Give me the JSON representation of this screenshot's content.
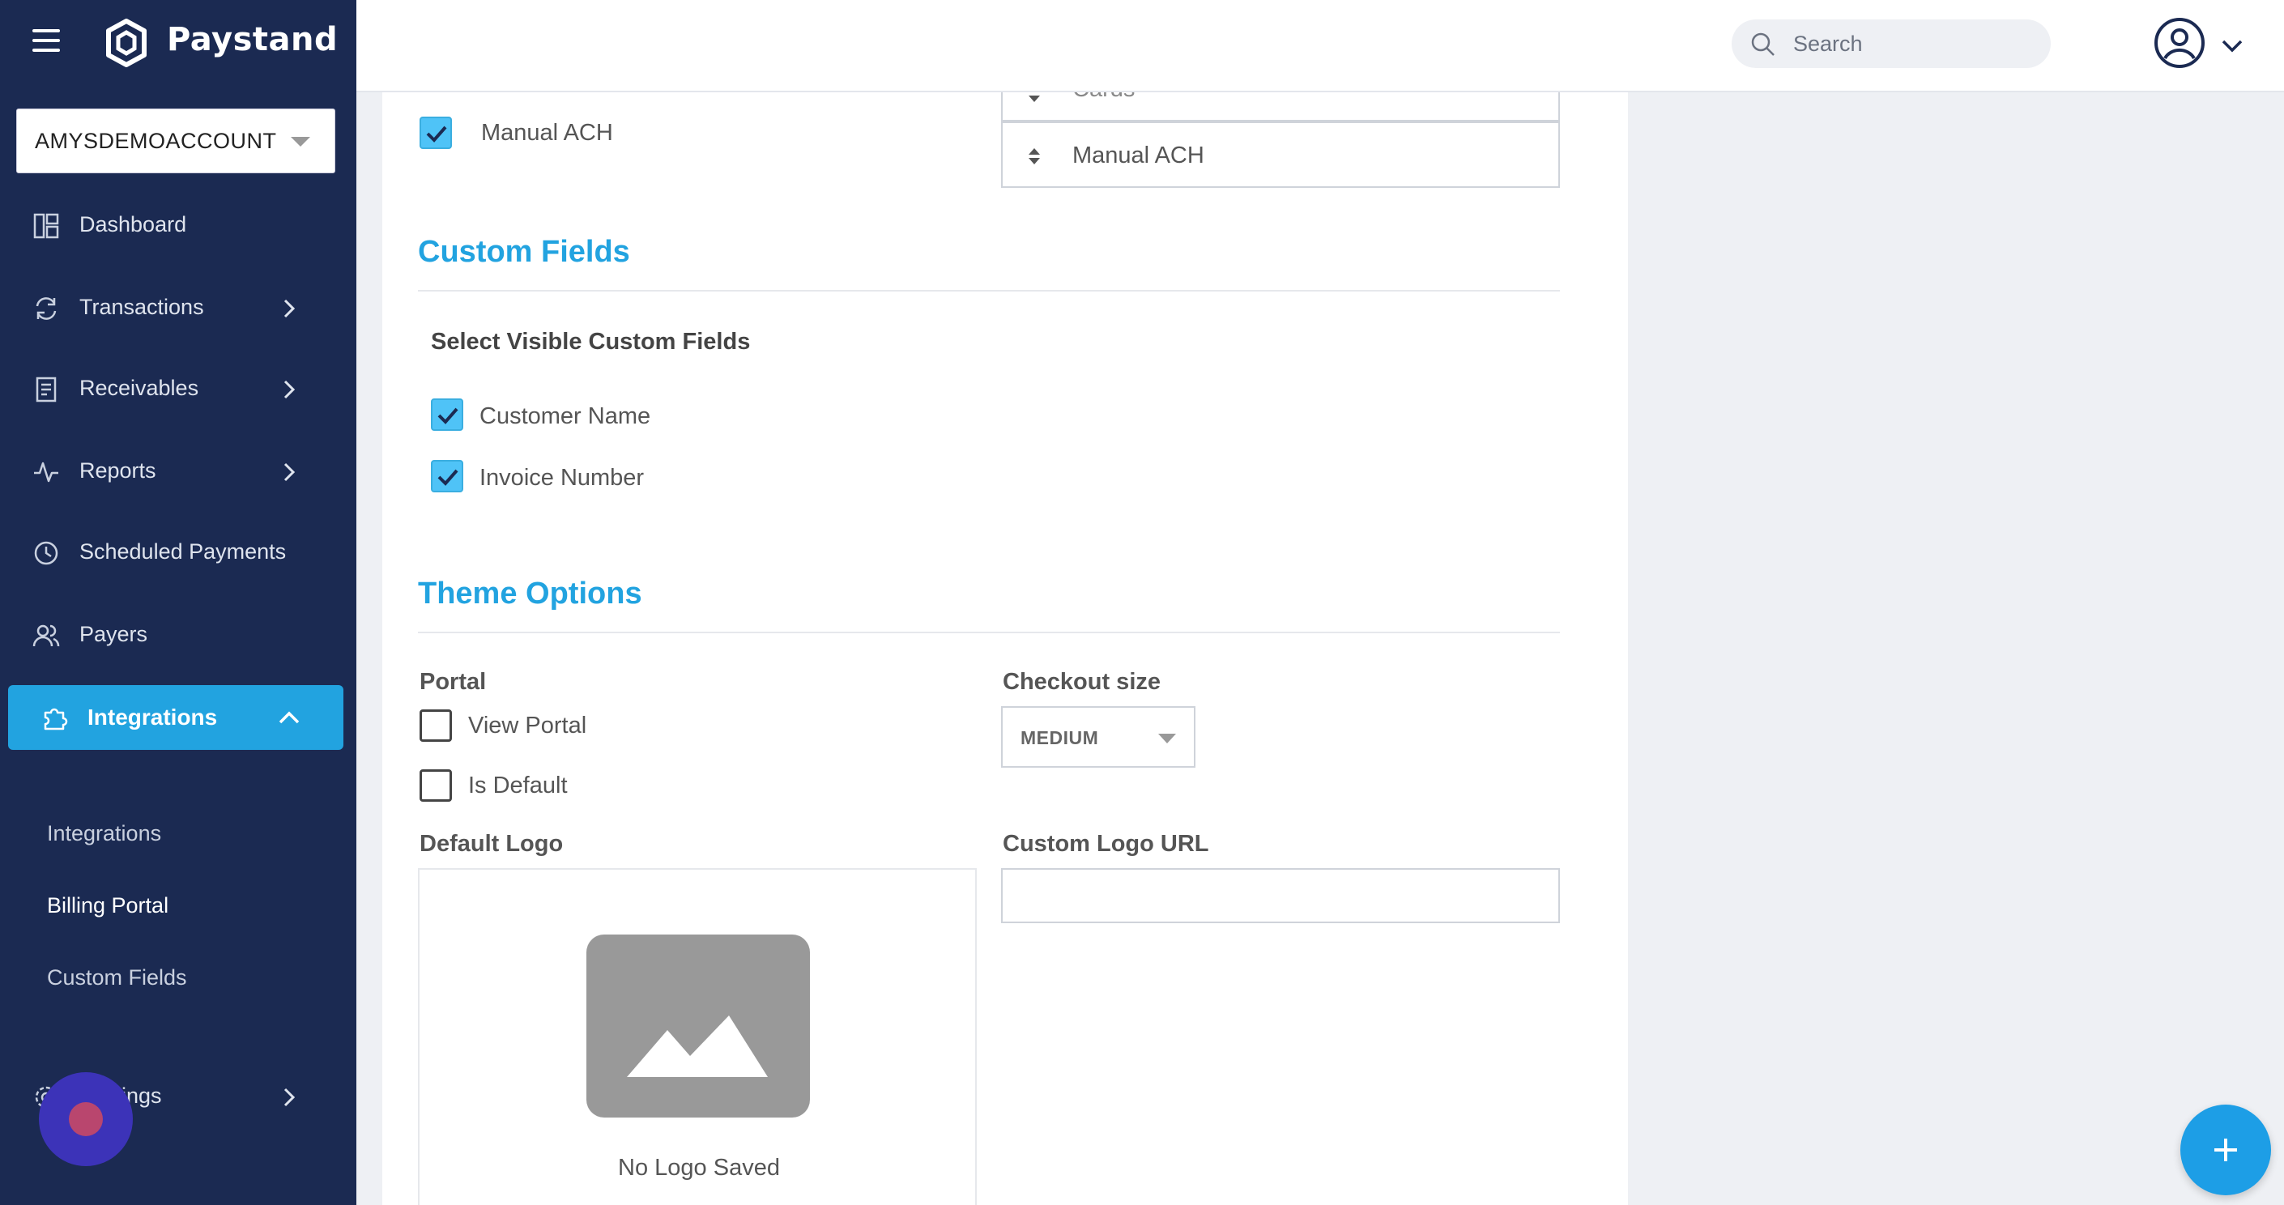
{
  "app": {
    "brand": "Paystand"
  },
  "account": {
    "name": "AMYSDEMOACCOUNT"
  },
  "search": {
    "placeholder": "Search"
  },
  "sidebar": {
    "items": [
      {
        "label": "Dashboard",
        "icon": "dashboard-icon"
      },
      {
        "label": "Transactions",
        "icon": "refresh-icon"
      },
      {
        "label": "Receivables",
        "icon": "receipt-icon"
      },
      {
        "label": "Reports",
        "icon": "activity-icon"
      },
      {
        "label": "Scheduled Payments",
        "icon": "clock-icon"
      },
      {
        "label": "Payers",
        "icon": "users-icon"
      }
    ],
    "active": {
      "label": "Integrations",
      "icon": "puzzle-icon"
    },
    "sub_items": [
      {
        "label": "Integrations"
      },
      {
        "label": "Billing Portal"
      },
      {
        "label": "Custom Fields"
      }
    ],
    "settings_partial": "ings"
  },
  "payment_methods": {
    "manual_ach_checkbox_label": "Manual ACH",
    "manual_ach_checked": true,
    "sort_items": [
      "Cards",
      "Manual ACH"
    ]
  },
  "custom_fields": {
    "title": "Custom Fields",
    "subhead": "Select Visible Custom Fields",
    "fields": [
      {
        "label": "Customer Name",
        "checked": true
      },
      {
        "label": "Invoice Number",
        "checked": true
      }
    ]
  },
  "theme_options": {
    "title": "Theme Options",
    "portal_label": "Portal",
    "view_portal": {
      "label": "View Portal",
      "checked": false
    },
    "is_default": {
      "label": "Is Default",
      "checked": false
    },
    "checkout_size_label": "Checkout size",
    "checkout_size_value": "MEDIUM",
    "default_logo_label": "Default Logo",
    "no_logo_text": "No Logo Saved",
    "custom_logo_url_label": "Custom Logo URL",
    "custom_logo_url_value": ""
  },
  "colors": {
    "sidebar": "#1b2a52",
    "accent": "#22a3e0",
    "checkbox": "#4fc3f7"
  }
}
